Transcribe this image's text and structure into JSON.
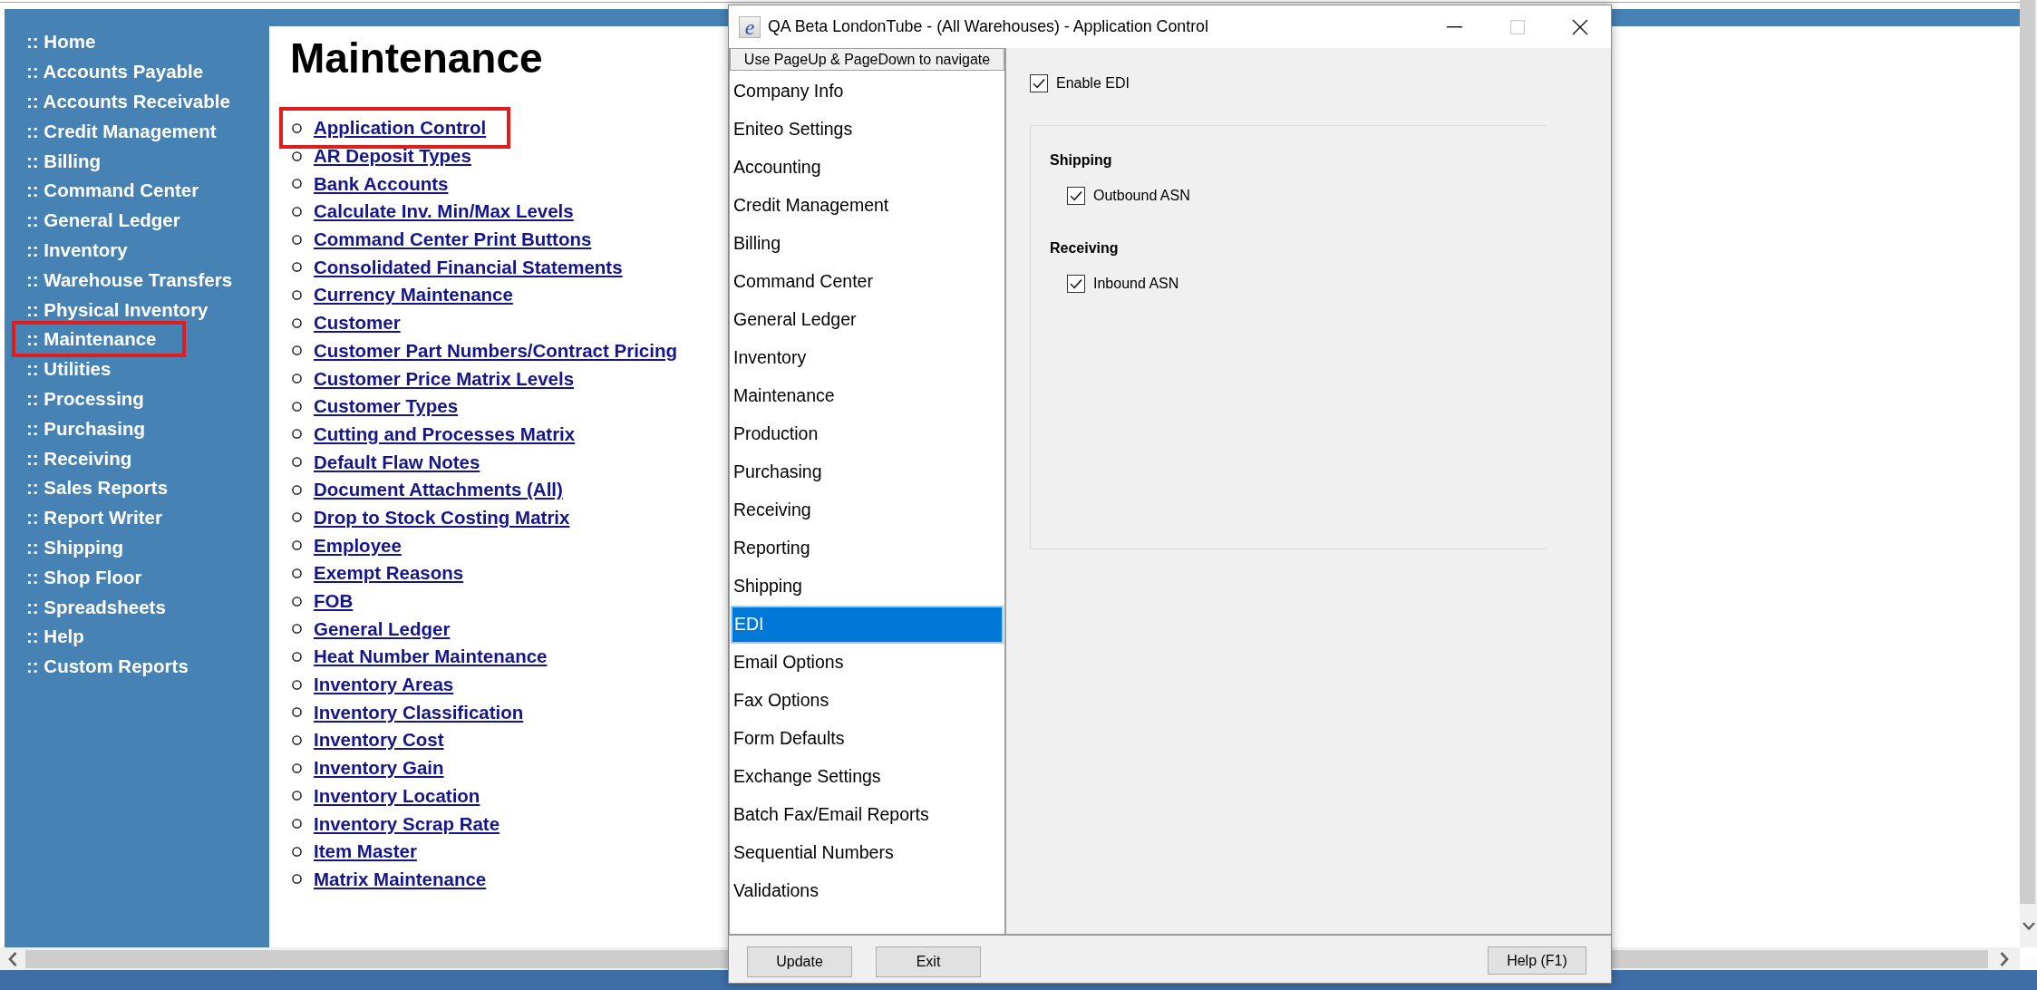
{
  "sidebar": {
    "items": [
      {
        "label": ":: Home",
        "highlighted": false
      },
      {
        "label": ":: Accounts Payable",
        "highlighted": false
      },
      {
        "label": ":: Accounts Receivable",
        "highlighted": false
      },
      {
        "label": ":: Credit Management",
        "highlighted": false
      },
      {
        "label": ":: Billing",
        "highlighted": false
      },
      {
        "label": ":: Command Center",
        "highlighted": false
      },
      {
        "label": ":: General Ledger",
        "highlighted": false
      },
      {
        "label": ":: Inventory",
        "highlighted": false
      },
      {
        "label": ":: Warehouse Transfers",
        "highlighted": false
      },
      {
        "label": ":: Physical Inventory",
        "highlighted": false
      },
      {
        "label": ":: Maintenance",
        "highlighted": true
      },
      {
        "label": ":: Utilities",
        "highlighted": false
      },
      {
        "label": ":: Processing",
        "highlighted": false
      },
      {
        "label": ":: Purchasing",
        "highlighted": false
      },
      {
        "label": ":: Receiving",
        "highlighted": false
      },
      {
        "label": ":: Sales Reports",
        "highlighted": false
      },
      {
        "label": ":: Report Writer",
        "highlighted": false
      },
      {
        "label": ":: Shipping",
        "highlighted": false
      },
      {
        "label": ":: Shop Floor",
        "highlighted": false
      },
      {
        "label": ":: Spreadsheets",
        "highlighted": false
      },
      {
        "label": ":: Help",
        "highlighted": false
      },
      {
        "label": ":: Custom Reports",
        "highlighted": false
      }
    ]
  },
  "page": {
    "title": "Maintenance",
    "links": [
      {
        "label": "Application Control",
        "highlighted": true
      },
      {
        "label": "AR Deposit Types",
        "highlighted": false
      },
      {
        "label": "Bank Accounts",
        "highlighted": false
      },
      {
        "label": "Calculate Inv. Min/Max Levels",
        "highlighted": false
      },
      {
        "label": "Command Center Print Buttons",
        "highlighted": false
      },
      {
        "label": "Consolidated Financial Statements",
        "highlighted": false
      },
      {
        "label": "Currency Maintenance",
        "highlighted": false
      },
      {
        "label": "Customer",
        "highlighted": false
      },
      {
        "label": "Customer Part Numbers/Contract Pricing",
        "highlighted": false
      },
      {
        "label": "Customer Price Matrix Levels",
        "highlighted": false
      },
      {
        "label": "Customer Types",
        "highlighted": false
      },
      {
        "label": "Cutting and Processes Matrix",
        "highlighted": false
      },
      {
        "label": "Default Flaw Notes",
        "highlighted": false
      },
      {
        "label": "Document Attachments (All)",
        "highlighted": false
      },
      {
        "label": "Drop to Stock Costing Matrix",
        "highlighted": false
      },
      {
        "label": "Employee",
        "highlighted": false
      },
      {
        "label": "Exempt Reasons",
        "highlighted": false
      },
      {
        "label": "FOB",
        "highlighted": false
      },
      {
        "label": "General Ledger",
        "highlighted": false
      },
      {
        "label": "Heat Number Maintenance",
        "highlighted": false
      },
      {
        "label": "Inventory Areas",
        "highlighted": false
      },
      {
        "label": "Inventory Classification",
        "highlighted": false
      },
      {
        "label": "Inventory Cost",
        "highlighted": false
      },
      {
        "label": "Inventory Gain",
        "highlighted": false
      },
      {
        "label": "Inventory Location",
        "highlighted": false
      },
      {
        "label": "Inventory Scrap Rate",
        "highlighted": false
      },
      {
        "label": "Item Master",
        "highlighted": false
      },
      {
        "label": "Matrix Maintenance",
        "highlighted": false
      }
    ]
  },
  "dialog": {
    "app_icon": "e",
    "title": "QA Beta LondonTube - (All Warehouses) - Application Control",
    "window_buttons": [
      {
        "kind": "minimize",
        "disabled": false
      },
      {
        "kind": "maximize",
        "disabled": true
      },
      {
        "kind": "close",
        "disabled": false
      }
    ],
    "nav_hint": "Use PageUp & PageDown to navigate",
    "categories": [
      {
        "label": "Company Info",
        "selected": false
      },
      {
        "label": "Eniteo Settings",
        "selected": false
      },
      {
        "label": "Accounting",
        "selected": false
      },
      {
        "label": "Credit Management",
        "selected": false
      },
      {
        "label": "Billing",
        "selected": false
      },
      {
        "label": "Command Center",
        "selected": false
      },
      {
        "label": "General Ledger",
        "selected": false
      },
      {
        "label": "Inventory",
        "selected": false
      },
      {
        "label": "Maintenance",
        "selected": false
      },
      {
        "label": "Production",
        "selected": false
      },
      {
        "label": "Purchasing",
        "selected": false
      },
      {
        "label": "Receiving",
        "selected": false
      },
      {
        "label": "Reporting",
        "selected": false
      },
      {
        "label": "Shipping",
        "selected": false
      },
      {
        "label": "EDI",
        "selected": true
      },
      {
        "label": "Email Options",
        "selected": false
      },
      {
        "label": "Fax Options",
        "selected": false
      },
      {
        "label": "Form Defaults",
        "selected": false
      },
      {
        "label": "Exchange Settings",
        "selected": false
      },
      {
        "label": "Batch Fax/Email Reports",
        "selected": false
      },
      {
        "label": "Sequential Numbers",
        "selected": false
      },
      {
        "label": "Validations",
        "selected": false
      }
    ],
    "settings": {
      "enable": {
        "label": "Enable EDI",
        "checked": true
      },
      "groups": [
        {
          "heading": "Shipping",
          "options": [
            {
              "label": "Outbound ASN",
              "checked": true
            }
          ]
        },
        {
          "heading": "Receiving",
          "options": [
            {
              "label": "Inbound ASN",
              "checked": true
            }
          ]
        }
      ]
    },
    "buttons": [
      {
        "label": "Update",
        "kind": "action"
      },
      {
        "label": "Exit",
        "kind": "action"
      },
      {
        "label": "Help (F1)",
        "kind": "help"
      }
    ]
  }
}
